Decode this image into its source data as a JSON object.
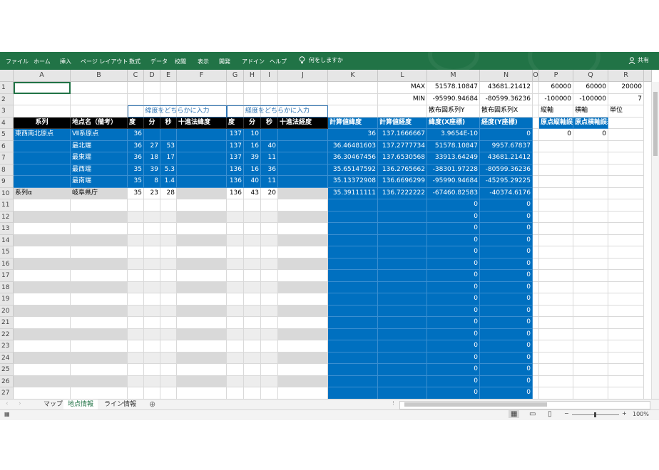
{
  "ribbon": {
    "tabs": [
      "ファイル",
      "ホーム",
      "挿入",
      "ページ レイアウト",
      "数式",
      "データ",
      "校閲",
      "表示",
      "開発",
      "アドイン",
      "ヘルプ"
    ],
    "tell_me": "何をしますか",
    "share": "共有"
  },
  "columns": [
    "A",
    "B",
    "C",
    "D",
    "E",
    "F",
    "G",
    "H",
    "I",
    "J",
    "K",
    "L",
    "M",
    "N",
    "O",
    "P",
    "Q",
    "R"
  ],
  "rows": [
    "1",
    "2",
    "3",
    "4",
    "5",
    "6",
    "7",
    "8",
    "9",
    "10",
    "11",
    "12",
    "13",
    "14",
    "15",
    "16",
    "17",
    "18",
    "19",
    "20",
    "21",
    "22",
    "23",
    "24",
    "25",
    "26",
    "27"
  ],
  "summary": {
    "max_label": "MAX",
    "max_m": "51578.10847",
    "max_n": "43681.21412",
    "min_label": "MIN",
    "min_m": "-95990.94684",
    "min_n": "-80599.36236",
    "p1": "60000",
    "q1": "60000",
    "r1": "20000",
    "p2": "-100000",
    "q2": "-100000",
    "r2": "7"
  },
  "row3": {
    "lat_box": "緯度をどちらかに入力",
    "lon_box": "経度をどちらかに入力",
    "m": "散布図系列Y",
    "n": "散布図系列X",
    "p": "縦軸",
    "q": "横軸",
    "r": "単位"
  },
  "headers": {
    "a": "系列",
    "b": "地点名（備考）",
    "c": "度",
    "d": "分",
    "e": "秒",
    "f": "十進法緯度",
    "g": "度",
    "h": "分",
    "i": "秒",
    "j": "十進法経度",
    "k": "計算値緯度",
    "l": "計算値経度",
    "m": "緯度(X座標)",
    "n": "経度(Y座標)",
    "p": "原点縦軸誤差",
    "q": "原点横軸誤差"
  },
  "data_rows": [
    {
      "a": "東西南北原点",
      "b": "Ⅶ系原点",
      "c": "36",
      "d": "",
      "e": "",
      "g": "137",
      "h": "10",
      "i": "",
      "k": "36",
      "l": "137.1666667",
      "m": "3.9654E-10",
      "n": "0",
      "p": "0",
      "q": "0"
    },
    {
      "a": "",
      "b": "最北端",
      "c": "36",
      "d": "27",
      "e": "53",
      "g": "137",
      "h": "16",
      "i": "40",
      "k": "36.46481603",
      "l": "137.2777734",
      "m": "51578.10847",
      "n": "9957.67837"
    },
    {
      "a": "",
      "b": "最東端",
      "c": "36",
      "d": "18",
      "e": "17",
      "g": "137",
      "h": "39",
      "i": "11",
      "k": "36.30467456",
      "l": "137.6530568",
      "m": "33913.64249",
      "n": "43681.21412"
    },
    {
      "a": "",
      "b": "最西端",
      "c": "35",
      "d": "39",
      "e": "5.3",
      "g": "136",
      "h": "16",
      "i": "36",
      "k": "35.65147592",
      "l": "136.2765662",
      "m": "-38301.97228",
      "n": "-80599.36236"
    },
    {
      "a": "",
      "b": "最南端",
      "c": "35",
      "d": "8",
      "e": "1.4",
      "g": "136",
      "h": "40",
      "i": "11",
      "k": "35.13372908",
      "l": "136.6696299",
      "m": "-95990.94684",
      "n": "-45295.29225"
    },
    {
      "a": "系列α",
      "b": "岐阜県庁",
      "c": "35",
      "d": "23",
      "e": "28",
      "g": "136",
      "h": "43",
      "i": "20",
      "k": "35.39111111",
      "l": "136.7222222",
      "m": "-67460.82583",
      "n": "-40374.6176"
    }
  ],
  "zero": "0",
  "sheets": [
    "マップ",
    "地点情報",
    "ライン情報"
  ],
  "add_sheet": "⊕",
  "zoom": "100%",
  "zoom_minus": "−",
  "zoom_plus": "+"
}
